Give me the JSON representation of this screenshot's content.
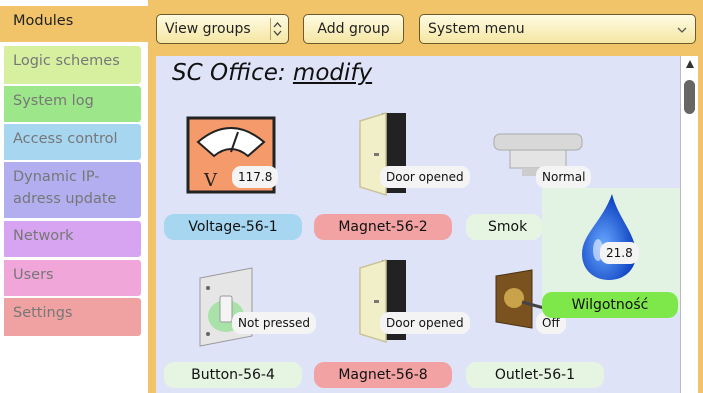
{
  "sidebar": {
    "items": [
      {
        "label": "Modules",
        "color": "#f1c46a",
        "active": true
      },
      {
        "label": "Logic schemes",
        "color": "#d6f0a0"
      },
      {
        "label": "System log",
        "color": "#9de68a"
      },
      {
        "label": "Access control",
        "color": "#a6d6f0"
      },
      {
        "label": "Dynamic IP-adress update",
        "line1": "Dynamic IP-",
        "line2": "adress update",
        "color": "#b3aef0"
      },
      {
        "label": "Network",
        "color": "#d6a4f0"
      },
      {
        "label": "Users",
        "color": "#f0a6d8"
      },
      {
        "label": "Settings",
        "color": "#f0a2a2"
      }
    ]
  },
  "toolbar": {
    "view_groups": "View groups",
    "add_group": "Add group",
    "system_menu": "System menu"
  },
  "page": {
    "title": "SC Office:",
    "mode": "modify"
  },
  "devices": [
    {
      "name": "Voltage-56-1",
      "status": "117.8",
      "icon": "voltmeter-icon",
      "label_color": "#a6d6f0"
    },
    {
      "name": "Magnet-56-2",
      "status": "Door opened",
      "icon": "door-icon",
      "label_color": "#f2a2a2"
    },
    {
      "name": "Smok",
      "status": "Normal",
      "icon": "smoke-detector-icon",
      "label_color": "#e6f4e2"
    },
    {
      "name": "Button-56-4",
      "status": "Not pressed",
      "icon": "switch-icon",
      "label_color": "#e6f4e2"
    },
    {
      "name": "Magnet-56-8",
      "status": "Door opened",
      "icon": "door-icon",
      "label_color": "#f2a2a2"
    },
    {
      "name": "Outlet-56-1",
      "status": "Off",
      "icon": "outlet-icon",
      "label_color": "#e6f4e2"
    }
  ],
  "popup": {
    "name": "Wilgotność",
    "value": "21.8",
    "icon": "water-drop-icon"
  }
}
